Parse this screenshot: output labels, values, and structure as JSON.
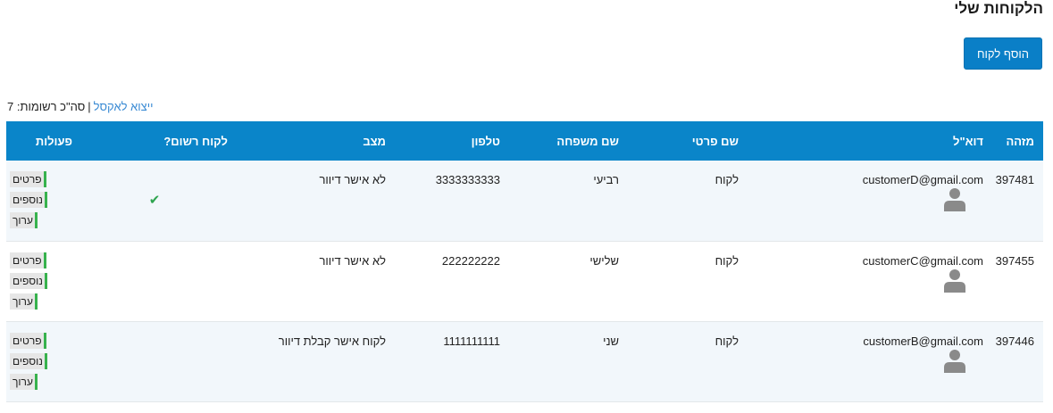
{
  "page": {
    "title": "הלקוחות שלי"
  },
  "toolbar": {
    "add_label": "הוסף לקוח"
  },
  "summary": {
    "export_label": "ייצוא לאקסל",
    "separator": "|",
    "count_text": "סה\"כ רשומות: 7"
  },
  "table": {
    "headers": {
      "id": "מזהה",
      "email": "דוא\"ל",
      "first_name": "שם פרטי",
      "last_name": "שם משפחה",
      "phone": "טלפון",
      "status": "מצב",
      "registered": "לקוח רשום?",
      "actions": "פעולות"
    },
    "rows": [
      {
        "id": "397481",
        "email": "customerD@gmail.com",
        "first_name": "לקוח",
        "last_name": "רביעי",
        "phone": "3333333333",
        "status": "לא אישר דיוור",
        "registered": "✔"
      },
      {
        "id": "397455",
        "email": "customerC@gmail.com",
        "first_name": "לקוח",
        "last_name": "שלישי",
        "phone": "222222222",
        "status": "לא אישר דיוור",
        "registered": ""
      },
      {
        "id": "397446",
        "email": "customerB@gmail.com",
        "first_name": "לקוח",
        "last_name": "שני",
        "phone": "1111111111",
        "status": "לקוח אישר קבלת דיוור",
        "registered": ""
      }
    ],
    "actions": {
      "details_line1": "פרטים",
      "details_line2": "נוספים",
      "edit": "ערוך"
    }
  },
  "icons": {
    "avatar": "user-avatar-icon",
    "registered": "check-icon"
  },
  "colors": {
    "accent": "#0a85c9",
    "button": "#0a7fc7",
    "check": "#2ea44f",
    "action_marker": "#37b24d",
    "link": "#3b8bd4"
  }
}
